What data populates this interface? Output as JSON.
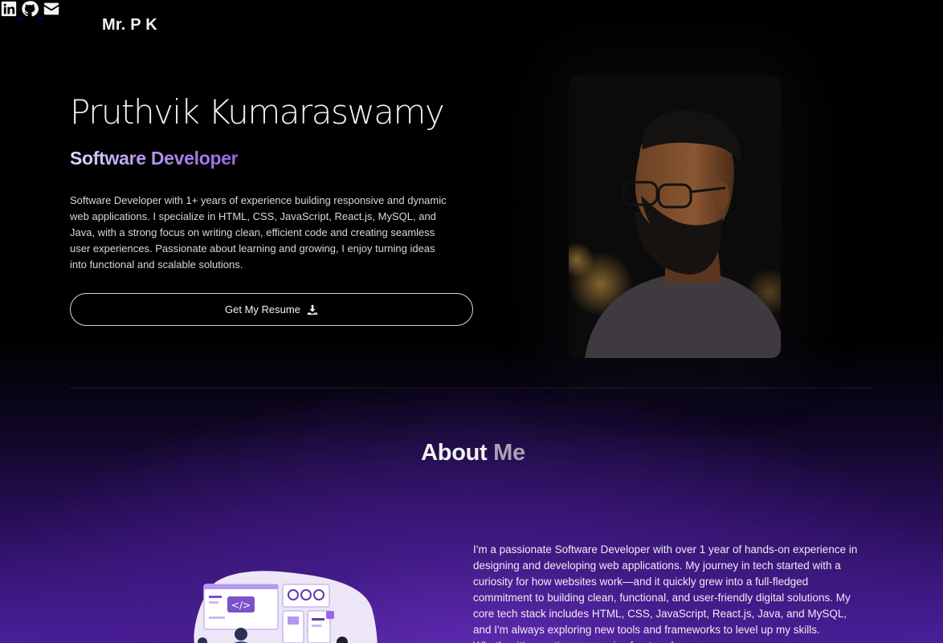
{
  "header": {
    "logo": "Mr. P K",
    "social": [
      {
        "icon": "linkedin-icon"
      },
      {
        "icon": "github-icon"
      },
      {
        "icon": "envelope-icon"
      }
    ]
  },
  "hero": {
    "name": "Pruthvik Kumaraswamy",
    "role": "Software Developer",
    "description": "Software Developer with 1+ years of experience building responsive and dynamic web applications. I specialize in HTML, CSS, JavaScript, React.js, MySQL, and Java, with a strong focus on writing clean, efficient code and creating seamless user experiences. Passionate about learning and growing, I enjoy turning ideas into functional and scalable solutions.",
    "resume_button": "Get My Resume",
    "resume_icon": "download-icon"
  },
  "about": {
    "title_part1": "About",
    "title_part2": "Me",
    "text": "I'm a passionate Software Developer with over 1 year of hands-on experience in designing and developing web applications. My journey in tech started with a curiosity for how websites work—and it quickly grew into a full-fledged commitment to building clean, functional, and user-friendly digital solutions. My core tech stack includes HTML, CSS, JavaScript, React.js, Java, and MySQL, and I'm always exploring new tools and frameworks to level up my skills. Whether it's creating responsive front-end",
    "illustration_code_glyph": "</>"
  },
  "colors": {
    "accent_purple": "#9a66e6",
    "background": "#000000"
  }
}
